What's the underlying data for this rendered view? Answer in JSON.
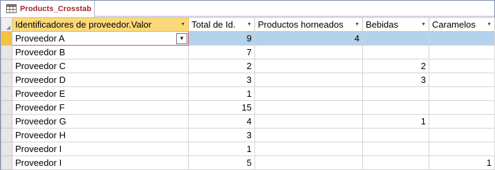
{
  "tab": {
    "title": "Products_Crosstab",
    "icon": "crosstab-query-icon"
  },
  "columns": [
    {
      "label": "Identificadores de proveedor.Valor",
      "selected": true
    },
    {
      "label": "Total de Id.",
      "selected": false
    },
    {
      "label": "Productos horneados",
      "selected": false
    },
    {
      "label": "Bebidas",
      "selected": false
    },
    {
      "label": "Caramelos",
      "selected": false
    }
  ],
  "rows": [
    {
      "supplier": "Proveedor A",
      "total": "9",
      "horneados": "4",
      "bebidas": "",
      "caramelos": ""
    },
    {
      "supplier": "Proveedor B",
      "total": "7",
      "horneados": "",
      "bebidas": "",
      "caramelos": ""
    },
    {
      "supplier": "Proveedor C",
      "total": "2",
      "horneados": "",
      "bebidas": "2",
      "caramelos": ""
    },
    {
      "supplier": "Proveedor D",
      "total": "3",
      "horneados": "",
      "bebidas": "3",
      "caramelos": ""
    },
    {
      "supplier": "Proveedor E",
      "total": "1",
      "horneados": "",
      "bebidas": "",
      "caramelos": ""
    },
    {
      "supplier": "Proveedor F",
      "total": "15",
      "horneados": "",
      "bebidas": "",
      "caramelos": ""
    },
    {
      "supplier": "Proveedor G",
      "total": "4",
      "horneados": "",
      "bebidas": "1",
      "caramelos": ""
    },
    {
      "supplier": "Proveedor H",
      "total": "3",
      "horneados": "",
      "bebidas": "",
      "caramelos": ""
    },
    {
      "supplier": "Proveedor I",
      "total": "1",
      "horneados": "",
      "bebidas": "",
      "caramelos": ""
    },
    {
      "supplier": "Proveedor I",
      "total": "5",
      "horneados": "",
      "bebidas": "",
      "caramelos": "1"
    }
  ],
  "current_row": 0,
  "colors": {
    "header_selected": "#fbd97a",
    "current_row": "#b4d2ec",
    "tab_title": "#a1262d"
  }
}
